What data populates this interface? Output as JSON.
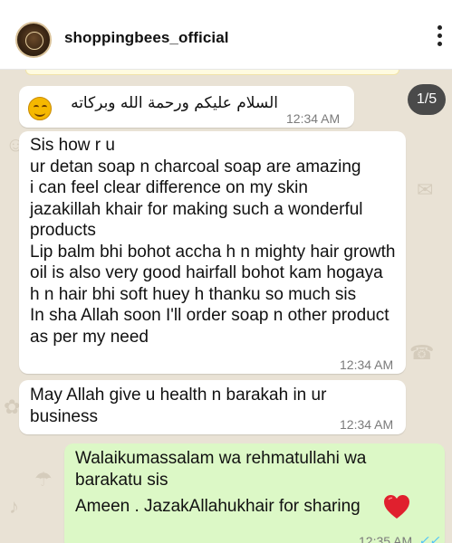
{
  "header": {
    "username": "shoppingbees_official"
  },
  "pager": {
    "label": "1/5"
  },
  "icons": [
    "avatar",
    "more-options-icon",
    "smile-emoji-icon",
    "red-heart-icon",
    "double-check-icon"
  ],
  "colors": {
    "incoming_bubble": "#ffffff",
    "outgoing_bubble": "#dcf8c6",
    "chat_background": "#e9e2d5",
    "read_ticks": "#4fc3f7",
    "heart": "#e0202e"
  },
  "messages": [
    {
      "text": "السلام عليكم ورحمة الله وبركاته",
      "time": "12:34 AM",
      "direction": "incoming"
    },
    {
      "text": "Sis how r u\nur detan soap n  charcoal soap  are amazing\ni can feel clear difference on my skin\njazakillah khair for making such a wonderful products\nLip balm bhi bohot accha h n mighty hair growth oil is also very good hairfall bohot kam hogaya h n hair bhi soft huey h thanku so much sis\nIn sha Allah soon  I'll order soap n other product as per my need",
      "time": "12:34 AM",
      "direction": "incoming"
    },
    {
      "text": "May Allah give u health n barakah in ur business",
      "time": "12:34 AM",
      "direction": "incoming"
    },
    {
      "text_line1": "Walaikumassalam wa rehmatullahi wa barakatu sis",
      "text_line2": "Ameen . JazakAllahukhair for sharing",
      "time": "12:35 AM",
      "ticks": "✓✓",
      "direction": "outgoing"
    }
  ]
}
